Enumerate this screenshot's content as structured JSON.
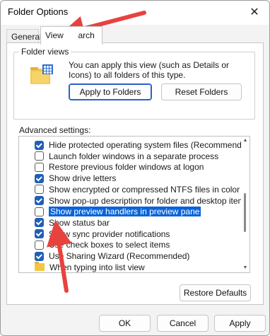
{
  "window": {
    "title": "Folder Options",
    "close_glyph": "✕"
  },
  "tabs": [
    {
      "label": "General"
    },
    {
      "label": "View"
    },
    {
      "label": "Search"
    }
  ],
  "folder_views": {
    "legend": "Folder views",
    "description": "You can apply this view (such as Details or Icons) to all folders of this type.",
    "apply_label": "Apply to Folders",
    "reset_label": "Reset Folders",
    "icon": "folder-view-icon"
  },
  "advanced": {
    "label": "Advanced settings:",
    "items": [
      {
        "label": "Hide protected operating system files (Recommended)",
        "checked": true,
        "kind": "checkbox"
      },
      {
        "label": "Launch folder windows in a separate process",
        "checked": false,
        "kind": "checkbox"
      },
      {
        "label": "Restore previous folder windows at logon",
        "checked": false,
        "kind": "checkbox"
      },
      {
        "label": "Show drive letters",
        "checked": true,
        "kind": "checkbox"
      },
      {
        "label": "Show encrypted or compressed NTFS files in color",
        "checked": false,
        "kind": "checkbox"
      },
      {
        "label": "Show pop-up description for folder and desktop items",
        "checked": true,
        "kind": "checkbox"
      },
      {
        "label": "Show preview handlers in preview pane",
        "checked": false,
        "kind": "checkbox",
        "selected": true
      },
      {
        "label": "Show status bar",
        "checked": true,
        "kind": "checkbox"
      },
      {
        "label": "Show sync provider notifications",
        "checked": true,
        "kind": "checkbox"
      },
      {
        "label": "Use check boxes to select items",
        "checked": false,
        "kind": "checkbox"
      },
      {
        "label": "Use Sharing Wizard (Recommended)",
        "checked": true,
        "kind": "checkbox"
      },
      {
        "label": "When typing into list view",
        "checked": false,
        "kind": "folder"
      }
    ]
  },
  "buttons": {
    "restore_defaults": "Restore Defaults",
    "ok": "OK",
    "cancel": "Cancel",
    "apply": "Apply"
  },
  "colors": {
    "accent": "#1f5fb8",
    "selection": "#0a64d8",
    "annotation_arrow": "#e8423f"
  }
}
